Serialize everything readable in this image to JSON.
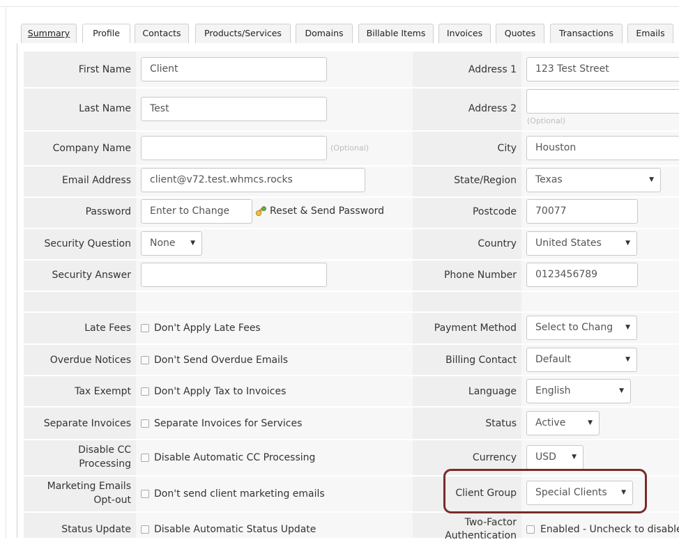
{
  "tabs": [
    {
      "label": "Summary"
    },
    {
      "label": "Profile"
    },
    {
      "label": "Contacts"
    },
    {
      "label": "Products/Services"
    },
    {
      "label": "Domains"
    },
    {
      "label": "Billable Items"
    },
    {
      "label": "Invoices"
    },
    {
      "label": "Quotes"
    },
    {
      "label": "Transactions"
    },
    {
      "label": "Emails"
    }
  ],
  "left": {
    "first_name": {
      "label": "First Name",
      "value": "Client"
    },
    "last_name": {
      "label": "Last Name",
      "value": "Test"
    },
    "company_name": {
      "label": "Company Name",
      "value": "",
      "hint": "(Optional)"
    },
    "email": {
      "label": "Email Address",
      "value": "client@v72.test.whmcs.rocks"
    },
    "password": {
      "label": "Password",
      "placeholder": "Enter to Change",
      "reset_link": "Reset & Send Password"
    },
    "security_question": {
      "label": "Security Question",
      "value": "None"
    },
    "security_answer": {
      "label": "Security Answer",
      "value": ""
    },
    "late_fees": {
      "label": "Late Fees",
      "checkbox": "Don't Apply Late Fees"
    },
    "overdue": {
      "label": "Overdue Notices",
      "checkbox": "Don't Send Overdue Emails"
    },
    "tax_exempt": {
      "label": "Tax Exempt",
      "checkbox": "Don't Apply Tax to Invoices"
    },
    "separate_invoices": {
      "label": "Separate Invoices",
      "checkbox": "Separate Invoices for Services"
    },
    "disable_cc": {
      "label_line1": "Disable CC",
      "label_line2": "Processing",
      "checkbox": "Disable Automatic CC Processing"
    },
    "marketing": {
      "label_line1": "Marketing Emails",
      "label_line2": "Opt-out",
      "checkbox": "Don't send client marketing emails"
    },
    "status_update": {
      "label": "Status Update",
      "checkbox": "Disable Automatic Status Update"
    }
  },
  "right": {
    "address1": {
      "label": "Address 1",
      "value": "123 Test Street"
    },
    "address2": {
      "label": "Address 2",
      "value": "",
      "hint": "(Optional)"
    },
    "city": {
      "label": "City",
      "value": "Houston"
    },
    "state": {
      "label": "State/Region",
      "value": "Texas"
    },
    "postcode": {
      "label": "Postcode",
      "value": "70077"
    },
    "country": {
      "label": "Country",
      "value": "United States"
    },
    "phone": {
      "label": "Phone Number",
      "value": "0123456789"
    },
    "payment_method": {
      "label": "Payment Method",
      "value": "Select to Chang"
    },
    "billing_contact": {
      "label": "Billing Contact",
      "value": "Default"
    },
    "language": {
      "label": "Language",
      "value": "English"
    },
    "status": {
      "label": "Status",
      "value": "Active"
    },
    "currency": {
      "label": "Currency",
      "value": "USD"
    },
    "client_group": {
      "label": "Client Group",
      "value": "Special Clients"
    },
    "two_factor": {
      "label_line1": "Two-Factor",
      "label_line2": "Authentication",
      "checkbox": "Enabled - Uncheck to disable"
    }
  },
  "colors": {
    "highlight": "#7b2a2a",
    "label_bg": "#efefef",
    "field_bg": "#f7f7f7"
  }
}
